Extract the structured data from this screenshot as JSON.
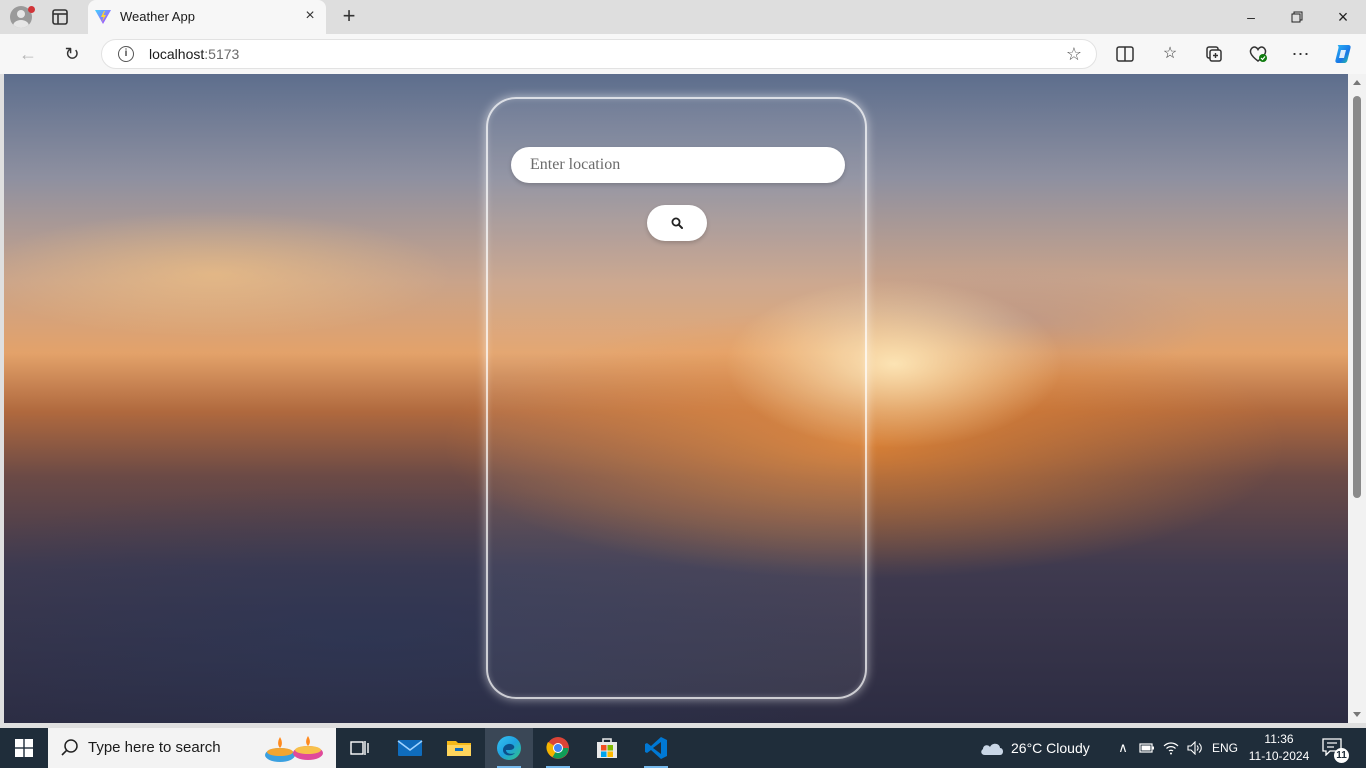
{
  "browser": {
    "tab_title": "Weather App",
    "url_host": "localhost",
    "url_port": ":5173"
  },
  "app": {
    "search": {
      "placeholder": "Enter location",
      "value": ""
    }
  },
  "taskbar": {
    "search_placeholder": "Type here to search",
    "weather_text": "26°C  Cloudy",
    "language": "ENG",
    "time": "11:36",
    "date": "11-10-2024",
    "notification_count": "11"
  },
  "colors": {
    "taskbar": "#1f2d3a",
    "chrome": "#f7f7f7",
    "accent_blue": "#0078d4"
  }
}
